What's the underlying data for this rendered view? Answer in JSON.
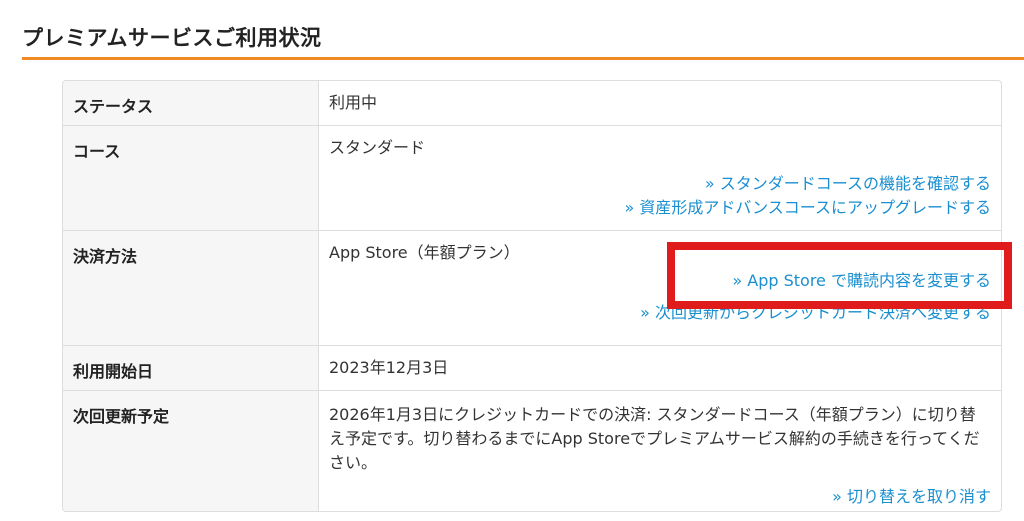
{
  "header": {
    "title": "プレミアムサービスご利用状況"
  },
  "rows": [
    {
      "label": "ステータス",
      "value": "利用中"
    },
    {
      "label": "コース",
      "value": "スタンダード",
      "links": [
        "» スタンダードコースの機能を確認する",
        "» 資産形成アドバンスコースにアップグレードする"
      ]
    },
    {
      "label": "決済方法",
      "value": "App Store（年額プラン）",
      "links": [
        "» App Store で購読内容を変更する",
        "» 次回更新からクレジットカード決済へ変更する"
      ]
    },
    {
      "label": "利用開始日",
      "value": "2023年12月3日"
    },
    {
      "label": "次回更新予定",
      "value": "2026年1月3日にクレジットカードでの決済: スタンダードコース（年額プラン）に切り替え予定です。切り替わるまでにApp Storeでプレミアムサービス解約の手続きを行ってください。",
      "links": [
        "» 切り替えを取り消す"
      ]
    }
  ],
  "colors": {
    "accent_rule": "#f08a24",
    "link": "#1a8fd0",
    "highlight": "#e01b1b"
  }
}
